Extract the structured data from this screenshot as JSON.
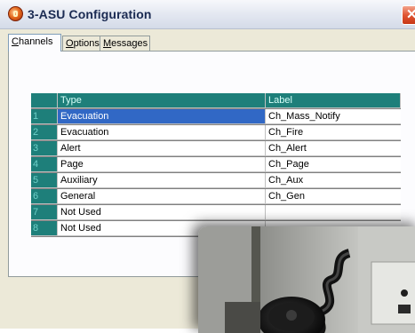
{
  "window": {
    "title": "3-ASU Configuration",
    "close_glyph": "✕"
  },
  "tabs": [
    {
      "label": "Channels",
      "underline": "C",
      "rest": "hannels",
      "active": true
    },
    {
      "label": "Options",
      "underline": "O",
      "rest": "ptions",
      "active": false
    },
    {
      "label": "Messages",
      "underline": "M",
      "rest": "essages",
      "active": false
    }
  ],
  "table": {
    "headers": {
      "num": "",
      "type": "Type",
      "label": "Label"
    },
    "rows": [
      {
        "num": "1",
        "type": "Evacuation",
        "label": "Ch_Mass_Notify",
        "selected": true
      },
      {
        "num": "2",
        "type": "Evacuation",
        "label": "Ch_Fire"
      },
      {
        "num": "3",
        "type": "Alert",
        "label": "Ch_Alert"
      },
      {
        "num": "4",
        "type": "Page",
        "label": "Ch_Page"
      },
      {
        "num": "5",
        "type": "Auxiliary",
        "label": "Ch_Aux"
      },
      {
        "num": "6",
        "type": "General",
        "label": "Ch_Gen"
      },
      {
        "num": "7",
        "type": "Not Used",
        "label": ""
      },
      {
        "num": "8",
        "type": "Not Used",
        "label": ""
      }
    ]
  },
  "colors": {
    "grid_header": "#1e7f7a",
    "selection": "#3168c5",
    "title_text": "#1a2a52"
  },
  "icons": {
    "app": "app-logo-icon",
    "close": "close-icon"
  }
}
